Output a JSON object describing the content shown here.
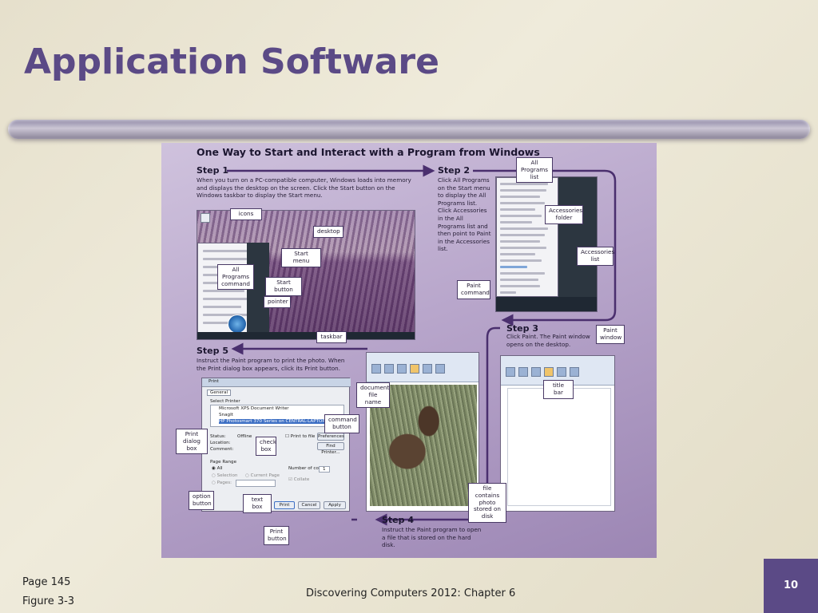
{
  "slide": {
    "title": "Application Software",
    "footer_left_line1": "Page 145",
    "footer_left_line2": "Figure 3-3",
    "footer_center": "Discovering Computers 2012: Chapter 6",
    "page_number": "10",
    "colors": {
      "title": "#5b4a86",
      "accent_box": "#5b4a86"
    }
  },
  "figure": {
    "heading": "One Way to Start and Interact with a Program from Windows",
    "step1": {
      "title": "Step 1",
      "text": "When you turn on a PC-compatible computer, Windows loads into memory and displays the desktop on the screen. Click the Start button on the Windows taskbar to display the Start menu."
    },
    "step2": {
      "title": "Step 2",
      "text": "Click All Programs on the Start menu to display the All Programs list. Click Accessories in the All Programs list and then point to Paint in the Accessories list."
    },
    "step3": {
      "title": "Step 3",
      "text": "Click Paint. The Paint window opens on the desktop."
    },
    "step4": {
      "title": "Step 4",
      "text": "Instruct the Paint program to open a file that is stored on the hard disk."
    },
    "step5": {
      "title": "Step 5",
      "text": "Instruct the Paint program to print the photo. When the Print dialog box appears, click its Print button."
    },
    "callouts": {
      "icons": "icons",
      "desktop": "desktop",
      "start_menu": "Start menu",
      "all_programs_command": "All Programs command",
      "start_button": "Start button",
      "pointer": "pointer",
      "taskbar": "taskbar",
      "all_programs_list": "All Programs list",
      "accessories_folder": "Accessories folder",
      "accessories_list": "Accessories list",
      "paint_command": "Paint command",
      "paint_window": "Paint window",
      "title_bar": "title bar",
      "document_file_name": "document file name",
      "file_contains_photo": "file contains photo stored on disk",
      "command_button": "command button",
      "print_dialog_box": "Print dialog box",
      "check_box": "check box",
      "option_button": "option button",
      "text_box": "text box",
      "print_button": "Print button"
    },
    "print_dialog": {
      "title": "Print",
      "tab": "General",
      "select_printer": "Select Printer",
      "printers": [
        "Microsoft XPS Document Writer",
        "SnagIt",
        "HP Photosmart 370 Series on CENTRAL-LAPTOP"
      ],
      "status_label": "Status:",
      "status_value": "Offline",
      "location_label": "Location:",
      "comment_label": "Comment:",
      "print_to_file": "Print to file",
      "preferences": "Preferences",
      "find_printer": "Find Printer...",
      "page_range": "Page Range",
      "all": "All",
      "selection": "Selection",
      "current_page": "Current Page",
      "pages": "Pages:",
      "number_of_copies": "Number of copies:",
      "copies_value": "1",
      "collate": "Collate",
      "print": "Print",
      "cancel": "Cancel",
      "apply": "Apply"
    }
  }
}
